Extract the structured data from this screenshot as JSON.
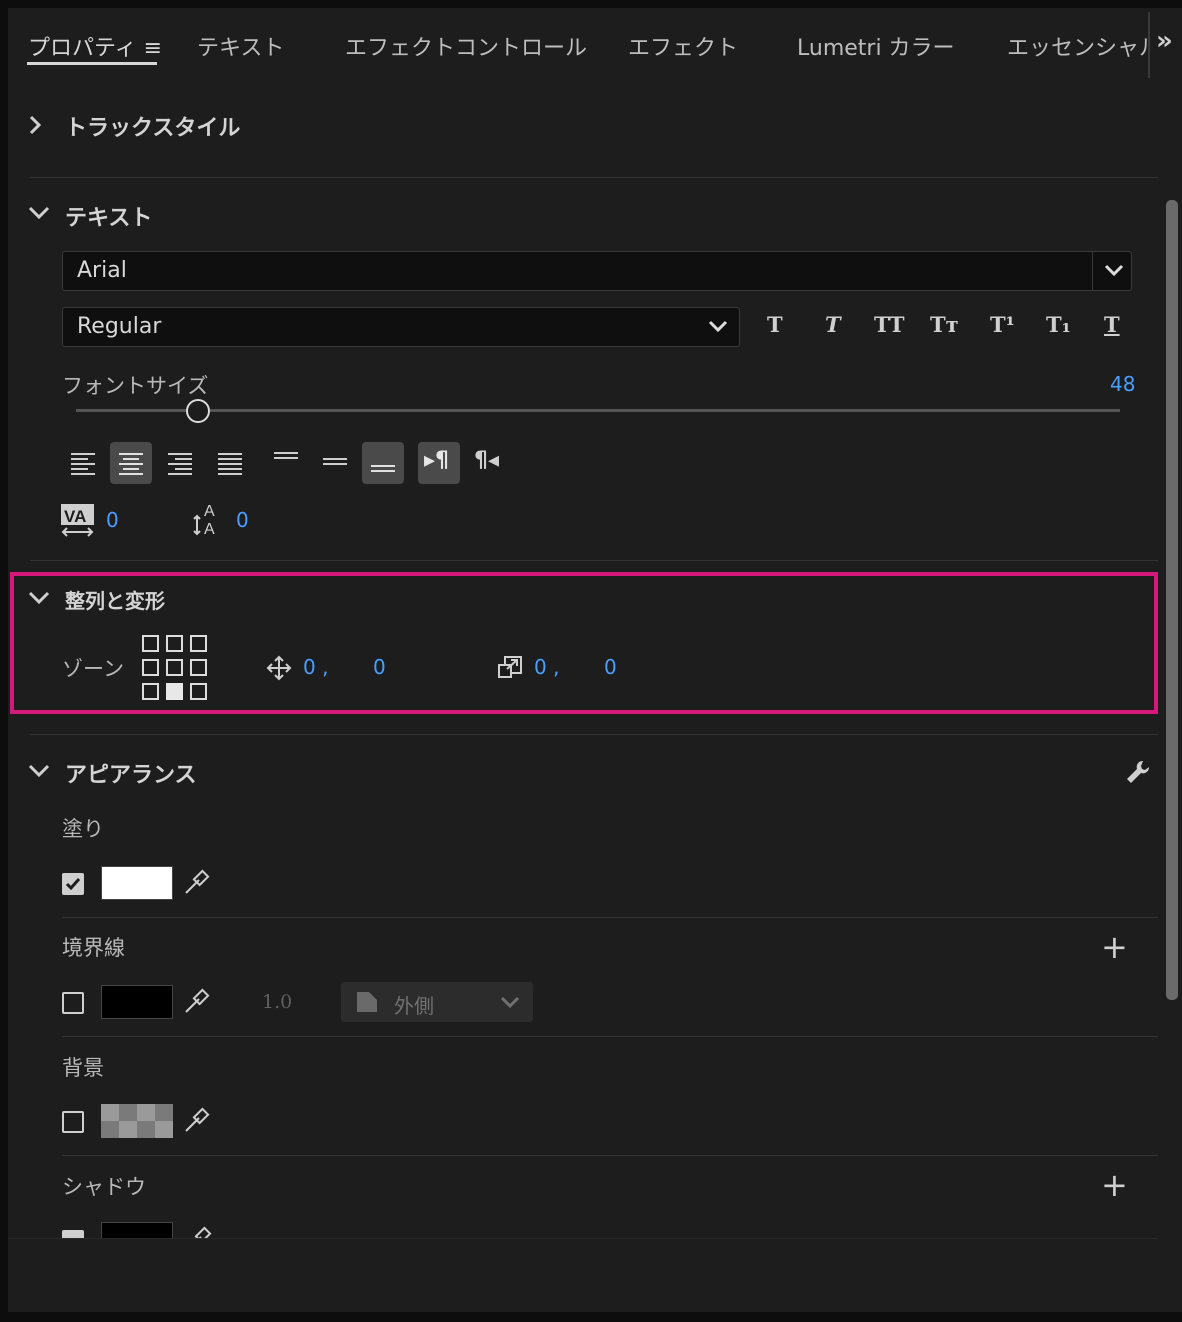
{
  "tabs": [
    {
      "label": "プロパティ ≡",
      "active": true
    },
    {
      "label": "テキスト"
    },
    {
      "label": "エフェクトコントロール"
    },
    {
      "label": "エフェクト"
    },
    {
      "label": "Lumetri カラー"
    },
    {
      "label": "エッセンシャル"
    }
  ],
  "tabs_overflow": "»",
  "sections": {
    "track_style": {
      "title": "トラックスタイル",
      "expanded": false
    },
    "text": {
      "title": "テキスト",
      "font_family": "Arial",
      "font_style": "Regular",
      "style_buttons": [
        "T",
        "T",
        "TT",
        "Tт",
        "T¹",
        "T₁",
        "T"
      ],
      "font_size_label": "フォントサイズ",
      "font_size_value": "48",
      "font_size_slider_fraction": 0.11,
      "kerning_value": "0",
      "leading_value": "0"
    },
    "align_transform": {
      "title": "整列と変形",
      "zone_label": "ゾーン",
      "position_x": "0 ,",
      "position_y": "0",
      "scale_x": "0 ,",
      "scale_y": "0"
    },
    "appearance": {
      "title": "アピアランス",
      "fill_label": "塗り",
      "fill_checked": true,
      "fill_color": "#ffffff",
      "stroke_label": "境界線",
      "stroke_checked": false,
      "stroke_color": "#000000",
      "stroke_width": "1.0",
      "stroke_position": "外側",
      "background_label": "背景",
      "background_checked": false,
      "shadow_label": "シャドウ",
      "shadow_checked": true,
      "plus": "+"
    }
  },
  "colors": {
    "accent_blue": "#4a9eff",
    "highlight": "#d4197a",
    "panel_bg": "#1d1d1d"
  }
}
